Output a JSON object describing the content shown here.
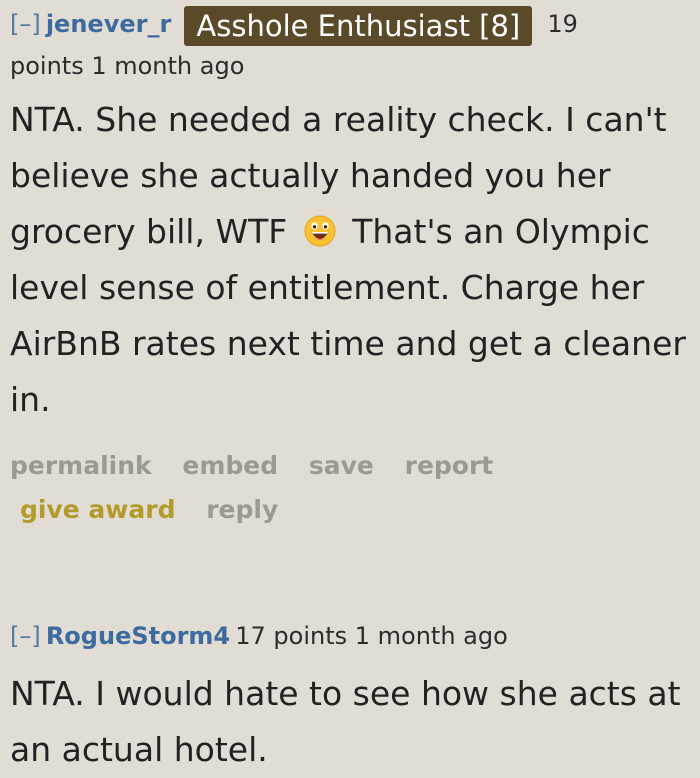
{
  "comments": [
    {
      "collapse": "[–]",
      "author": "jenever_r",
      "flair": "Asshole Enthusiast [8]",
      "score": "19",
      "meta": "points 1 month ago",
      "body_line1": "NTA. She needed a reality check. I can't believe she actually handed you her grocery bill, WTF",
      "emoji": "grinning-face-icon",
      "body_line2": "That's an Olympic level sense of entitlement. Charge her AirBnB rates next time and get a cleaner in.",
      "buttons": {
        "permalink": "permalink",
        "embed": "embed",
        "save": "save",
        "report": "report",
        "give_award": "give award",
        "reply": "reply"
      }
    },
    {
      "collapse": "[–]",
      "author": "RogueStorm4",
      "meta": "17 points 1 month ago",
      "body": "NTA. I would hate to see how she acts at an actual hotel."
    }
  ],
  "colors": {
    "background": "#e1ddd5",
    "author": "#3d6ba0",
    "flair_bg": "#5a4a2a",
    "award": "#b39b2a",
    "button": "#9a9a94"
  }
}
